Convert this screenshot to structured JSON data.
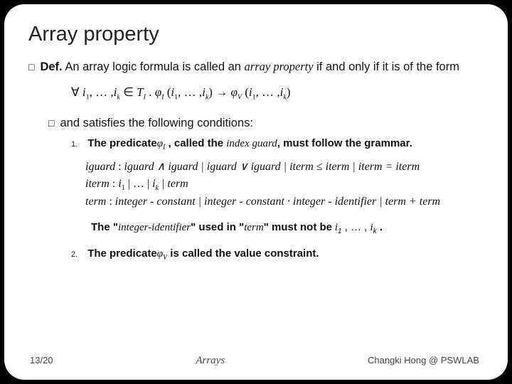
{
  "title": "Array property",
  "def": {
    "label": "Def.",
    "text_a": "An array logic formula is called an ",
    "term": "array property",
    "text_b": " if and only if it is of the form"
  },
  "formula": {
    "forall": "∀",
    "vars_a": "i",
    "sub1": "1",
    "dots": ", … ,",
    "vars_b": "i",
    "subk": "k",
    "in": " ∈ ",
    "T": "T",
    "TI": "I",
    "dot": " .  ",
    "phiI": "φ",
    "phiI_sub": "I",
    "open": " (",
    "args_a": "i",
    "close": ")",
    "arrow": " → ",
    "phiV": "φ",
    "phiV_sub": "V"
  },
  "cond_intro": "and satisfies the following conditions:",
  "item1": {
    "num": "1.",
    "text_a": "The predicate",
    "phi": "φ",
    "phi_sub": "I",
    "text_b": " , called the ",
    "term": "index guard",
    "text_c": ", must follow the grammar."
  },
  "grammar": {
    "l1a": "iguard",
    "l1b": " : ",
    "l1c": "iguard ∧ iguard | iguard ∨ iguard | iterm ≤ iterm | iterm = iterm",
    "l2a": "iterm",
    "l2b": " : ",
    "l2c": "i",
    "l2c1": "1",
    "l2d": " | … | ",
    "l2e": "i",
    "l2e1": "k",
    "l2f": " | term",
    "l3a": "term",
    "l3b": " : ",
    "l3c": "integer - constant | integer - constant · integer - identifier | term + term"
  },
  "note": {
    "text_a": "The  \"",
    "term1": "integer-identifier",
    "text_b": "\" used in \"",
    "term2": "term",
    "text_c": "\" must not be",
    "vars": " i",
    "sub1": "1",
    "dots": " , … , ",
    "vars2": "i",
    "subk": "k",
    "tail": " ."
  },
  "item2": {
    "num": "2.",
    "text_a": "The predicate",
    "phi": "φ",
    "phi_sub": "V",
    "text_b": " is called the value constraint."
  },
  "footer": {
    "left": "13/20",
    "center": "Arrays",
    "right": "Changki Hong @ PSWLAB"
  }
}
